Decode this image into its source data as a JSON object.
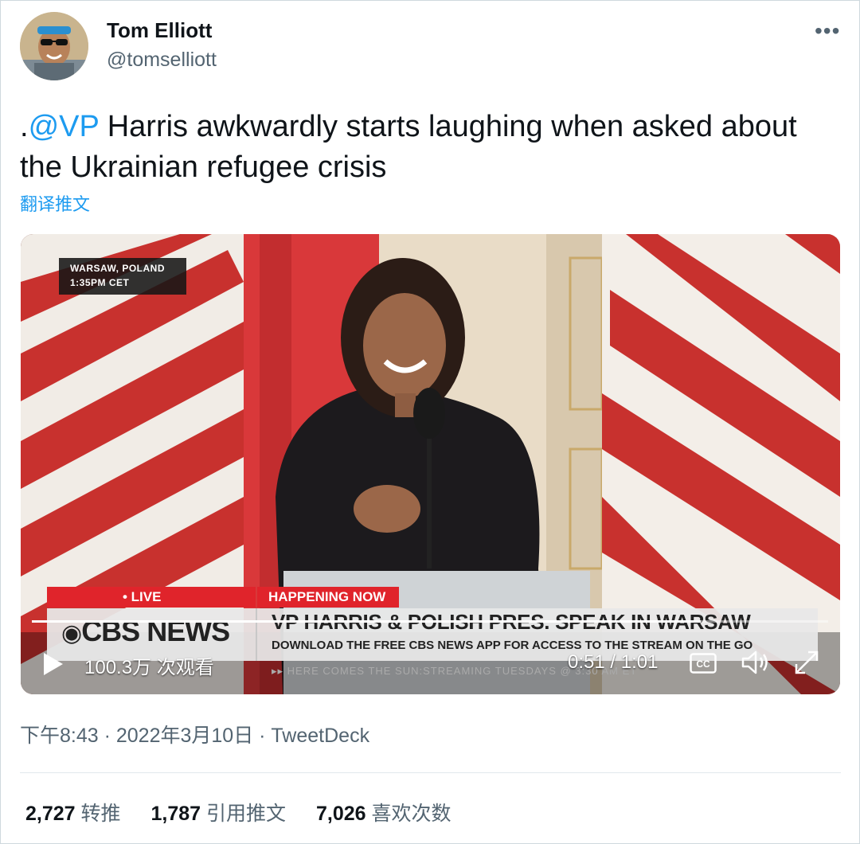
{
  "author": {
    "name": "Tom Elliott",
    "handle": "@tomselliott",
    "avatar_icon": "profile-photo-sunglasses"
  },
  "more_icon": "more-horizontal-icon",
  "tweet": {
    "prefix": ".",
    "mention": "@VP",
    "text": " Harris awkwardly starts laughing when asked about the Ukrainian refugee crisis",
    "translate_label": "翻译推文"
  },
  "video": {
    "location_line1": "WARSAW, POLAND",
    "location_line2": "1:35PM CET",
    "live_label": "• LIVE",
    "happening_label": "HAPPENING NOW",
    "network": "CBS NEWS",
    "headline": "VP HARRIS & POLISH PRES. SPEAK IN WARSAW",
    "subline": "DOWNLOAD THE FREE CBS NEWS APP FOR ACCESS TO THE STREAM ON THE GO",
    "crawl": "▸▸ HERE COMES THE SUN:STREAMING TUESDAYS @ 3:30 AM ET",
    "views": "100.3万 次观看",
    "time": "0:51 / 1:01",
    "progress": 0.84,
    "cc_label": "CC"
  },
  "meta": {
    "text": "下午8:43 · 2022年3月10日 · TweetDeck"
  },
  "stats": [
    {
      "count": "2,727",
      "label": "转推"
    },
    {
      "count": "1,787",
      "label": "引用推文"
    },
    {
      "count": "7,026",
      "label": "喜欢次数"
    }
  ],
  "colors": {
    "accent": "#1d9bf0",
    "secondary_text": "#536471",
    "live_red": "#e0242b"
  }
}
